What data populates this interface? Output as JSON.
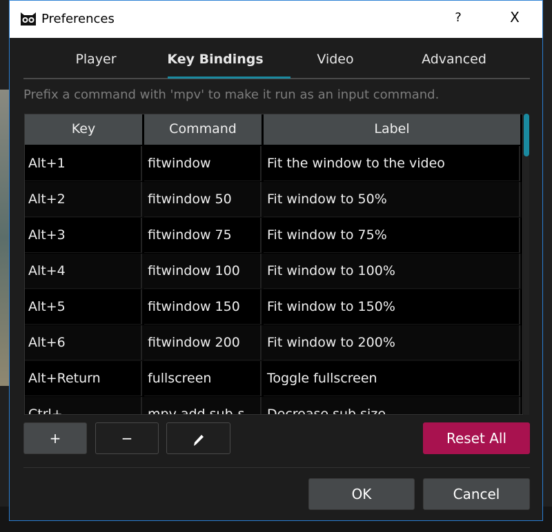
{
  "window": {
    "title": "Preferences",
    "help": "?",
    "close": "X"
  },
  "tabs": [
    {
      "label": "Player"
    },
    {
      "label": "Key Bindings",
      "active": true
    },
    {
      "label": "Video"
    },
    {
      "label": "Advanced"
    }
  ],
  "hint": "Prefix a command with 'mpv' to make it run as an input command.",
  "table": {
    "headers": [
      "Key",
      "Command",
      "Label"
    ],
    "rows": [
      [
        "Alt+1",
        "fitwindow",
        "Fit the window to the video"
      ],
      [
        "Alt+2",
        "fitwindow 50",
        "Fit window to 50%"
      ],
      [
        "Alt+3",
        "fitwindow 75",
        "Fit window to 75%"
      ],
      [
        "Alt+4",
        "fitwindow 100",
        "Fit window to 100%"
      ],
      [
        "Alt+5",
        "fitwindow 150",
        "Fit window to 150%"
      ],
      [
        "Alt+6",
        "fitwindow 200",
        "Fit window to 200%"
      ],
      [
        "Alt+Return",
        "fullscreen",
        "Toggle fullscreen"
      ],
      [
        "Ctrl+-",
        "mpv add sub-s",
        "Decrease sub size"
      ]
    ]
  },
  "buttons": {
    "add": "+",
    "remove": "−",
    "reset_all": "Reset All",
    "ok": "OK",
    "cancel": "Cancel"
  },
  "colors": {
    "accent": "#1a8aa0",
    "reset": "#a8124f"
  }
}
